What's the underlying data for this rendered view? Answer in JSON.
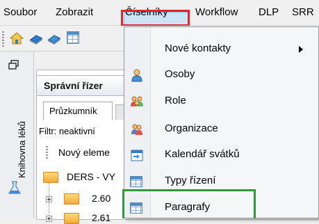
{
  "menubar": {
    "items": [
      {
        "label": "Soubor"
      },
      {
        "label": "Zobrazit"
      },
      {
        "label": "Číselníky"
      },
      {
        "label": "Workflow"
      },
      {
        "label": "DLP"
      },
      {
        "label": "SRR"
      }
    ],
    "active_index": 2
  },
  "toolbar": {
    "icons": [
      "home-icon",
      "book-icon",
      "book-icon",
      "table-icon"
    ]
  },
  "sidebar": {
    "label": "Knihovna léků",
    "icons": [
      "restore-window-icon",
      "flask-icon"
    ]
  },
  "panel": {
    "title": "Správní řízer",
    "tab_label": "Průzkumník",
    "filter_label": "Filtr: neaktivní",
    "new_element_label": "Nový eleme",
    "tree": [
      {
        "label": "DERS - VY"
      },
      {
        "label": "2.60"
      },
      {
        "label": "2.61"
      }
    ]
  },
  "dropdown": {
    "items": [
      {
        "label": "Nové kontakty",
        "icon": "none",
        "has_submenu": true
      },
      {
        "label": "Osoby",
        "icon": "person-icon",
        "has_submenu": false
      },
      {
        "label": "Role",
        "icon": "people-group-icon",
        "has_submenu": false
      },
      {
        "label": "Organizace",
        "icon": "organization-icon",
        "has_submenu": false
      },
      {
        "label": "Kalendář svátků",
        "icon": "calendar-icon",
        "has_submenu": false
      },
      {
        "label": "Typy řízení",
        "icon": "table-icon",
        "has_submenu": false
      },
      {
        "label": "Paragrafy",
        "icon": "table-icon",
        "has_submenu": false
      }
    ]
  },
  "colors": {
    "menu_highlight": "#e4242c",
    "item_highlight": "#2f9a3c",
    "menu_open": "#cde4f7"
  }
}
